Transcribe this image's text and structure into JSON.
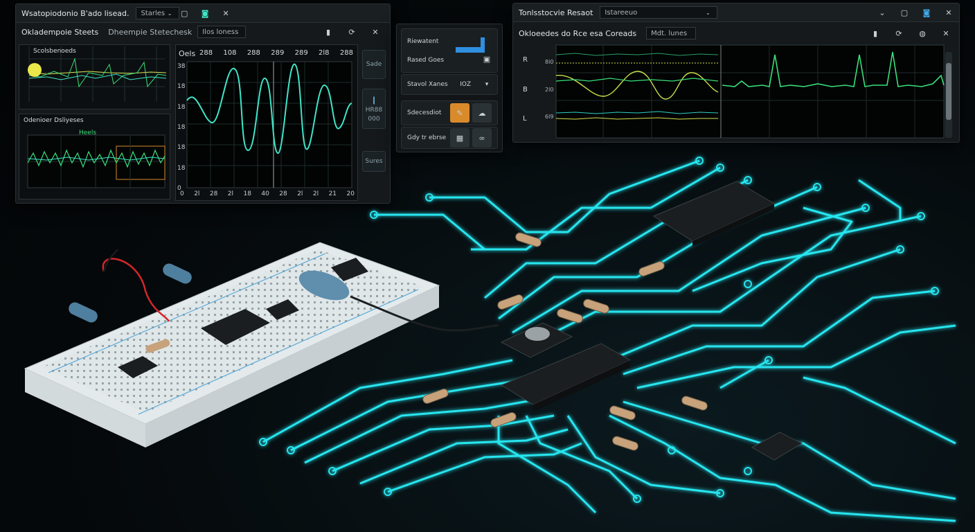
{
  "left_window": {
    "title": "Wsatopiodonio B'ado lisead.",
    "dropdown": "Starles",
    "sub_tab1": "Okladempoie Steets",
    "sub_tab2": "Dheempie Stetechesk",
    "sub_dropdown": "Ilos loness",
    "mini_plot1_title": "Scolsbenoeds",
    "mini_plot2_title": "Odenioer Dsliyeses",
    "mini_plot2_label": "Heels",
    "main_plot_label": "Oels",
    "main_x_top": [
      "288",
      "108",
      "288",
      "289",
      "289",
      "2l8",
      "288"
    ],
    "main_y": [
      "38",
      "18",
      "18",
      "18",
      "18",
      "18",
      "0"
    ],
    "main_x_bottom": [
      "0",
      "2l",
      "28",
      "2l",
      "18",
      "40",
      "28",
      "2l",
      "2l",
      "21",
      "20"
    ],
    "side_buttons": [
      "Sade",
      "HR88",
      "000",
      "Sures"
    ]
  },
  "center_window": {
    "rows": [
      {
        "label": "Riewatent"
      },
      {
        "label": "Rased Goes"
      },
      {
        "label": "Stavol Xanes",
        "value": "IOZ"
      },
      {
        "label": "Sdecesdiot"
      },
      {
        "label": "Gdy tr ebrse"
      }
    ]
  },
  "right_window": {
    "title": "Tonlsstocvie Resaot",
    "dropdown": "Istareeuo",
    "sub_title": "Okloeedes do Rce esa Coreads",
    "sub_dropdown": "Mdt. lunes",
    "y_labels": [
      "R",
      "B",
      "L"
    ],
    "y_ticks": [
      "8l0",
      "2l0",
      "6l9"
    ]
  },
  "colors": {
    "trace_green": "#39e07a",
    "trace_cyan": "#3fe6c8",
    "trace_yellow": "#d6e04a",
    "pcb_trace": "#26e5ef",
    "accent_blue": "#2f8fe0",
    "accent_orange": "#d98a2b"
  },
  "icons": [
    "minimize-icon",
    "restore-icon",
    "close-icon",
    "chevron-down-icon",
    "settings-icon",
    "refresh-icon"
  ]
}
